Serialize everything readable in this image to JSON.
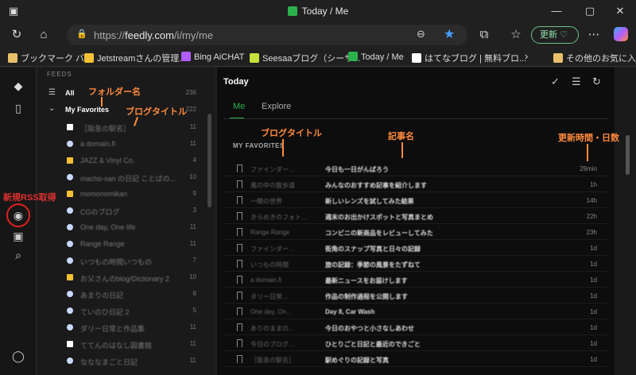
{
  "window": {
    "title": "Today / Me",
    "minimize": "—",
    "maximize": "▢",
    "close": "✕"
  },
  "navbar": {
    "url_prefix": "https://",
    "url_domain": "feedly.com",
    "url_path": "/i/my/me",
    "update_label": "更新"
  },
  "bookmarks": [
    {
      "label": "ブックマーク バー",
      "icon": "folder-icon",
      "color": "#e8c06a"
    },
    {
      "label": "Jetstreamさんの管理...",
      "icon": "s-icon",
      "color": "#f5c033"
    },
    {
      "label": "Bing AiCHAT",
      "icon": "copilot-icon",
      "color": "#b05cff"
    },
    {
      "label": "Seesaaブログ（シーサ...",
      "icon": "seesaa-icon",
      "color": "#c6e33a"
    },
    {
      "label": "Today / Me",
      "icon": "feedly-icon",
      "color": "#2bb24c"
    },
    {
      "label": "はてなブログ | 無料ブロ...",
      "icon": "hatena-icon",
      "color": "#ffffff"
    },
    {
      "label": "その他のお気に入り",
      "icon": "folder-icon",
      "color": "#e8c06a"
    }
  ],
  "sidebar": {
    "feeds_label": "FEEDS",
    "all_label": "All",
    "all_count": "236",
    "favorites_label": "My Favorites",
    "favorites_count": "222",
    "feeds": [
      {
        "name": "［阪急の駅名］",
        "count": "11",
        "icon": "wh"
      },
      {
        "name": "a domain.fi",
        "count": "11",
        "icon": "dot"
      },
      {
        "name": "JAZZ & Vinyl Co.",
        "count": "4",
        "icon": "sq"
      },
      {
        "name": "macho-san の日記 ことばの...",
        "count": "10",
        "icon": "dot"
      },
      {
        "name": "momonomikan",
        "count": "9",
        "icon": "sq"
      },
      {
        "name": "CGのブログ",
        "count": "3",
        "icon": "dot"
      },
      {
        "name": "One day, One life",
        "count": "11",
        "icon": "dot"
      },
      {
        "name": "Range Range",
        "count": "11",
        "icon": "dot"
      },
      {
        "name": "いつもの時間いつもの",
        "count": "7",
        "icon": "dot"
      },
      {
        "name": "お父さんのblog/Dictionary 2",
        "count": "10",
        "icon": "sq"
      },
      {
        "name": "あまりの日記",
        "count": "8",
        "icon": "dot"
      },
      {
        "name": "ていのひ日記 2",
        "count": "5",
        "icon": "dot"
      },
      {
        "name": "ダリー日常と作品集",
        "count": "11",
        "icon": "dot"
      },
      {
        "name": "ててんのはなし図書館",
        "count": "11",
        "icon": "wh"
      },
      {
        "name": "なななまごと日記",
        "count": "11",
        "icon": "dot"
      }
    ]
  },
  "main": {
    "title": "Today",
    "tabs": [
      "Me",
      "Explore"
    ],
    "section": "MY FAVORITES",
    "articles": [
      {
        "source": "ファインダー…",
        "title": "今日も一日がんばろう",
        "time": "29min"
      },
      {
        "source": "風の中の散歩道",
        "title": "みんなのおすすめ記事を紹介します",
        "time": "1h"
      },
      {
        "source": "一眼の世界",
        "title": "新しいレンズを試してみた結果",
        "time": "14h"
      },
      {
        "source": "きらめきのフォト…",
        "title": "週末のお出かけスポットと写真まとめ",
        "time": "22h"
      },
      {
        "source": "Range Range",
        "title": "コンビニの新商品をレビューしてみた",
        "time": "23h"
      },
      {
        "source": "ファインダー…",
        "title": "街角のスナップ写真と日々の記録",
        "time": "1d"
      },
      {
        "source": "いつもの時間",
        "title": "旅の記録：季節の風景をたずねて",
        "time": "1d"
      },
      {
        "source": "a domain.fi",
        "title": "最新ニュースをお届けします",
        "time": "1d"
      },
      {
        "source": "ダリー日常…",
        "title": "作品の制作過程を公開します",
        "time": "1d"
      },
      {
        "source": "One day, On…",
        "title": "Day 8, Car Wash",
        "time": "1d"
      },
      {
        "source": "ありのままの…",
        "title": "今日のおやつと小さなしあわせ",
        "time": "1d"
      },
      {
        "source": "今日のブログ…",
        "title": "ひとりごと日記と最近のできごと",
        "time": "1d"
      },
      {
        "source": "［阪急の駅名］",
        "title": "駅めぐりの記録と写真",
        "time": "1d"
      }
    ]
  },
  "annotations": {
    "folder": "フォルダー名",
    "blog_title_1": "ブログタイトル",
    "blog_title_2": "ブログタイトル",
    "article": "記事名",
    "updated": "更新時間・日数",
    "new_rss": "新規RSS取得"
  }
}
